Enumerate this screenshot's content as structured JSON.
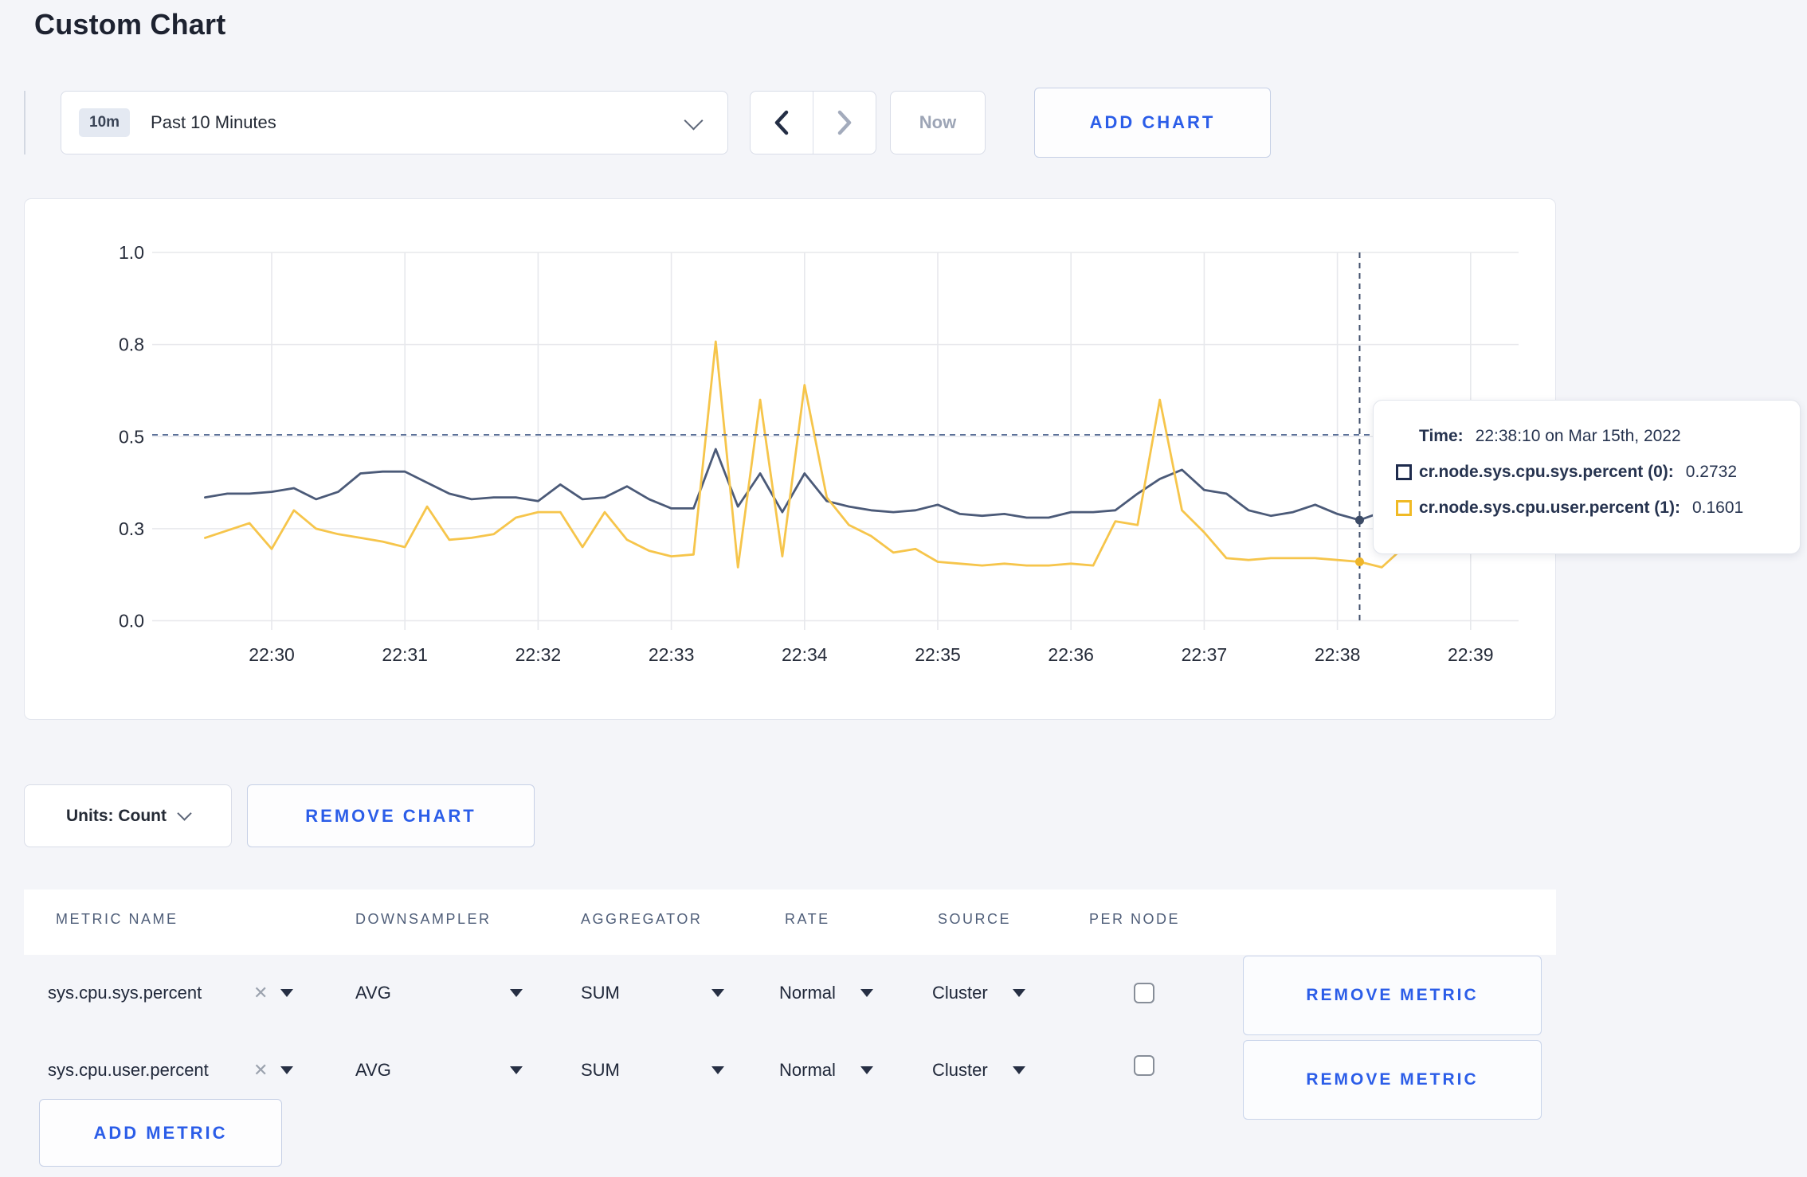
{
  "page": {
    "title": "Custom Chart"
  },
  "toolbar": {
    "time_badge": "10m",
    "time_label": "Past 10 Minutes",
    "now_label": "Now",
    "add_chart_label": "ADD CHART"
  },
  "chart_controls": {
    "units_label": "Units: Count",
    "remove_chart_label": "REMOVE CHART"
  },
  "tooltip": {
    "time_label": "Time:",
    "time_value": "22:38:10 on Mar 15th, 2022",
    "rows": [
      {
        "label": "cr.node.sys.cpu.sys.percent (0):",
        "value": "0.2732",
        "color": "#1e2b4d"
      },
      {
        "label": "cr.node.sys.cpu.user.percent (1):",
        "value": "0.1601",
        "color": "#f0ba25"
      }
    ]
  },
  "metrics_table": {
    "columns": [
      "METRIC NAME",
      "DOWNSAMPLER",
      "AGGREGATOR",
      "RATE",
      "SOURCE",
      "PER NODE"
    ],
    "rows": [
      {
        "metric": "sys.cpu.sys.percent",
        "downsampler": "AVG",
        "aggregator": "SUM",
        "rate": "Normal",
        "source": "Cluster",
        "per_node_checked": false,
        "remove_label": "REMOVE METRIC"
      },
      {
        "metric": "sys.cpu.user.percent",
        "downsampler": "AVG",
        "aggregator": "SUM",
        "rate": "Normal",
        "source": "Cluster",
        "per_node_checked": false,
        "remove_label": "REMOVE METRIC"
      }
    ],
    "add_metric_label": "ADD METRIC"
  },
  "chart_data": {
    "type": "line",
    "title": "Custom Chart",
    "grid": true,
    "legend_position": "tooltip",
    "x_axis": {
      "tick_labels": [
        "22:30",
        "22:31",
        "22:32",
        "22:33",
        "22:34",
        "22:35",
        "22:36",
        "22:37",
        "22:38",
        "22:39"
      ],
      "tick_minutes": [
        30,
        31,
        32,
        33,
        34,
        35,
        36,
        37,
        38,
        39
      ],
      "range_minutes": [
        29.45,
        39.35
      ]
    },
    "y_axis": {
      "tick_labels": [
        "0.0",
        "0.3",
        "0.5",
        "0.8",
        "1.0"
      ],
      "tick_values": [
        0,
        0.25,
        0.5,
        0.75,
        1
      ],
      "range": [
        0,
        1
      ]
    },
    "sampling": {
      "start_minute": 29.5,
      "step_seconds": 10
    },
    "series": [
      {
        "name": "cr.node.sys.cpu.sys.percent (0)",
        "color": "#4b5a78",
        "values": [
          0.335,
          0.345,
          0.345,
          0.35,
          0.36,
          0.33,
          0.35,
          0.4,
          0.405,
          0.405,
          0.375,
          0.345,
          0.33,
          0.335,
          0.335,
          0.325,
          0.37,
          0.33,
          0.335,
          0.365,
          0.33,
          0.305,
          0.305,
          0.466,
          0.31,
          0.4,
          0.295,
          0.4,
          0.325,
          0.31,
          0.3,
          0.295,
          0.3,
          0.315,
          0.29,
          0.285,
          0.29,
          0.28,
          0.28,
          0.295,
          0.295,
          0.3,
          0.345,
          0.385,
          0.41,
          0.355,
          0.345,
          0.3,
          0.285,
          0.295,
          0.315,
          0.29,
          0.2732,
          0.295,
          0.31,
          0.3,
          0.295,
          0.3,
          0.305
        ]
      },
      {
        "name": "cr.node.sys.cpu.user.percent (1)",
        "color": "#f6c54b",
        "values": [
          0.225,
          0.245,
          0.265,
          0.195,
          0.3,
          0.25,
          0.235,
          0.225,
          0.215,
          0.2,
          0.31,
          0.22,
          0.225,
          0.235,
          0.28,
          0.295,
          0.295,
          0.2,
          0.295,
          0.22,
          0.19,
          0.175,
          0.18,
          0.758,
          0.145,
          0.6,
          0.175,
          0.64,
          0.335,
          0.26,
          0.23,
          0.185,
          0.195,
          0.16,
          0.155,
          0.15,
          0.155,
          0.15,
          0.15,
          0.155,
          0.15,
          0.27,
          0.26,
          0.6,
          0.3,
          0.24,
          0.17,
          0.165,
          0.17,
          0.17,
          0.17,
          0.165,
          0.1601,
          0.145,
          0.2,
          0.27,
          0.22,
          0.19,
          0.27
        ]
      }
    ],
    "crosshair": {
      "time": "22:38:10 on Mar 15th, 2022",
      "x_minute": 38.1667,
      "hover_value": 0.505,
      "point_values": [
        0.2732,
        0.1601
      ],
      "dot_colors": [
        "#3c4b66",
        "#efb62a"
      ]
    }
  }
}
